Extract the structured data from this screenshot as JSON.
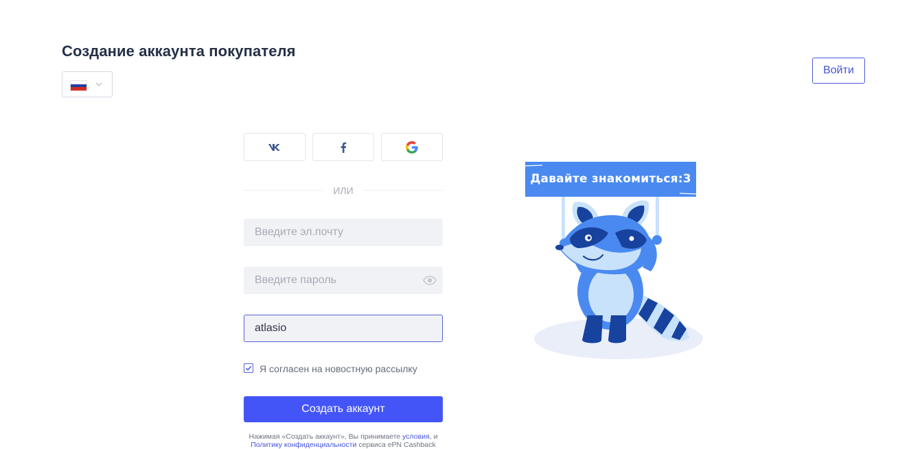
{
  "header": {
    "title": "Создание аккаунта покупателя",
    "login_label": "Войти"
  },
  "language": {
    "selected": "Russia",
    "flag_colors": [
      "#ffffff",
      "#1e3ea8",
      "#d52b1e"
    ]
  },
  "social": [
    {
      "name": "vk",
      "icon": "vk-icon",
      "color": "#3b5a8a"
    },
    {
      "name": "facebook",
      "icon": "facebook-icon",
      "color": "#3b5a8a"
    },
    {
      "name": "google",
      "icon": "google-icon"
    }
  ],
  "divider": {
    "label": "ИЛИ"
  },
  "form": {
    "email_placeholder": "Введите эл.почту",
    "email_value": "",
    "password_placeholder": "Введите пароль",
    "password_value": "",
    "third_value": "atlasio",
    "newsletter_label": "Я согласен на новостную рассылку",
    "newsletter_checked": true,
    "submit_label": "Создать аккаунт"
  },
  "terms": {
    "prefix": "Нажимая «Создать аккаунт», Вы принимаете ",
    "terms_link": "условия",
    "middle": ", и",
    "privacy_link": "Политику конфиденциальности",
    "suffix": " сервиса ePN Cashback"
  },
  "illustration": {
    "banner_text": "Давайте знакомиться:3",
    "colors": {
      "primary": "#4a8af0",
      "dark": "#17429e",
      "light": "#c9e2fb",
      "shadow": "#e9eef9"
    }
  },
  "colors": {
    "accent": "#4455f8",
    "title": "#243046"
  }
}
